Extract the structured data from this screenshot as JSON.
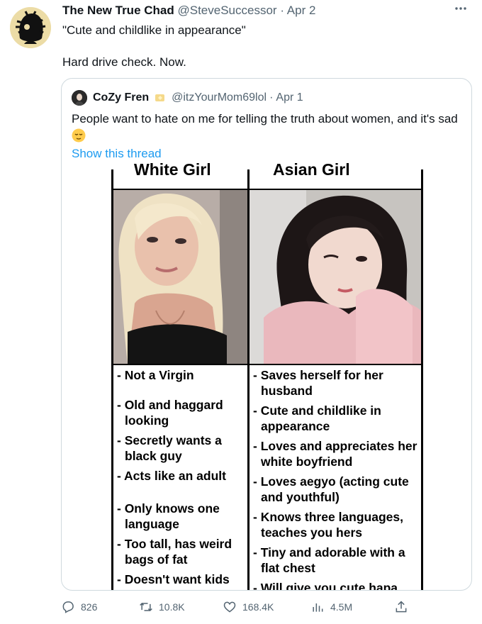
{
  "tweet": {
    "display_name": "The New True Chad",
    "handle": "@SteveSuccessor",
    "separator": "·",
    "date": "Apr 2",
    "more_icon": "more-icon",
    "text_line1": "\"Cute and childlike in appearance\"",
    "text_line2": "Hard drive check. Now."
  },
  "quoted": {
    "display_name": "CoZy Fren",
    "badge_icon": "sparkle-badge-icon",
    "handle": "@itzYourMom69lol",
    "separator": "·",
    "date": "Apr 1",
    "text": "People want to hate on me for telling the truth about women, and it's sad",
    "emoji": "relieved-face-emoji",
    "show_thread": "Show this thread",
    "image": {
      "left_title": "White Girl",
      "right_title": "Asian Girl",
      "left_items": [
        "- Not a Virgin",
        "- Old and haggard looking",
        "- Secretly wants a black guy",
        "- Acts like an adult",
        "- Only knows one language",
        "- Too tall, has weird bags of fat",
        "- Doesn't want kids"
      ],
      "right_items": [
        "- Saves herself for her husband",
        "- Cute and childlike in appearance",
        "- Loves and appreciates her white boyfriend",
        "- Loves aegyo (acting cute and youthful)",
        "- Knows three languages, teaches you hers",
        "- Tiny and adorable with a flat chest",
        "- Will give you cute hapa daughters"
      ]
    }
  },
  "actions": {
    "replies": "826",
    "retweets": "10.8K",
    "likes": "168.4K",
    "views": "4.5M"
  },
  "colors": {
    "link": "#1d9bf0",
    "secondary_text": "#536471",
    "border": "#cfd9de"
  }
}
